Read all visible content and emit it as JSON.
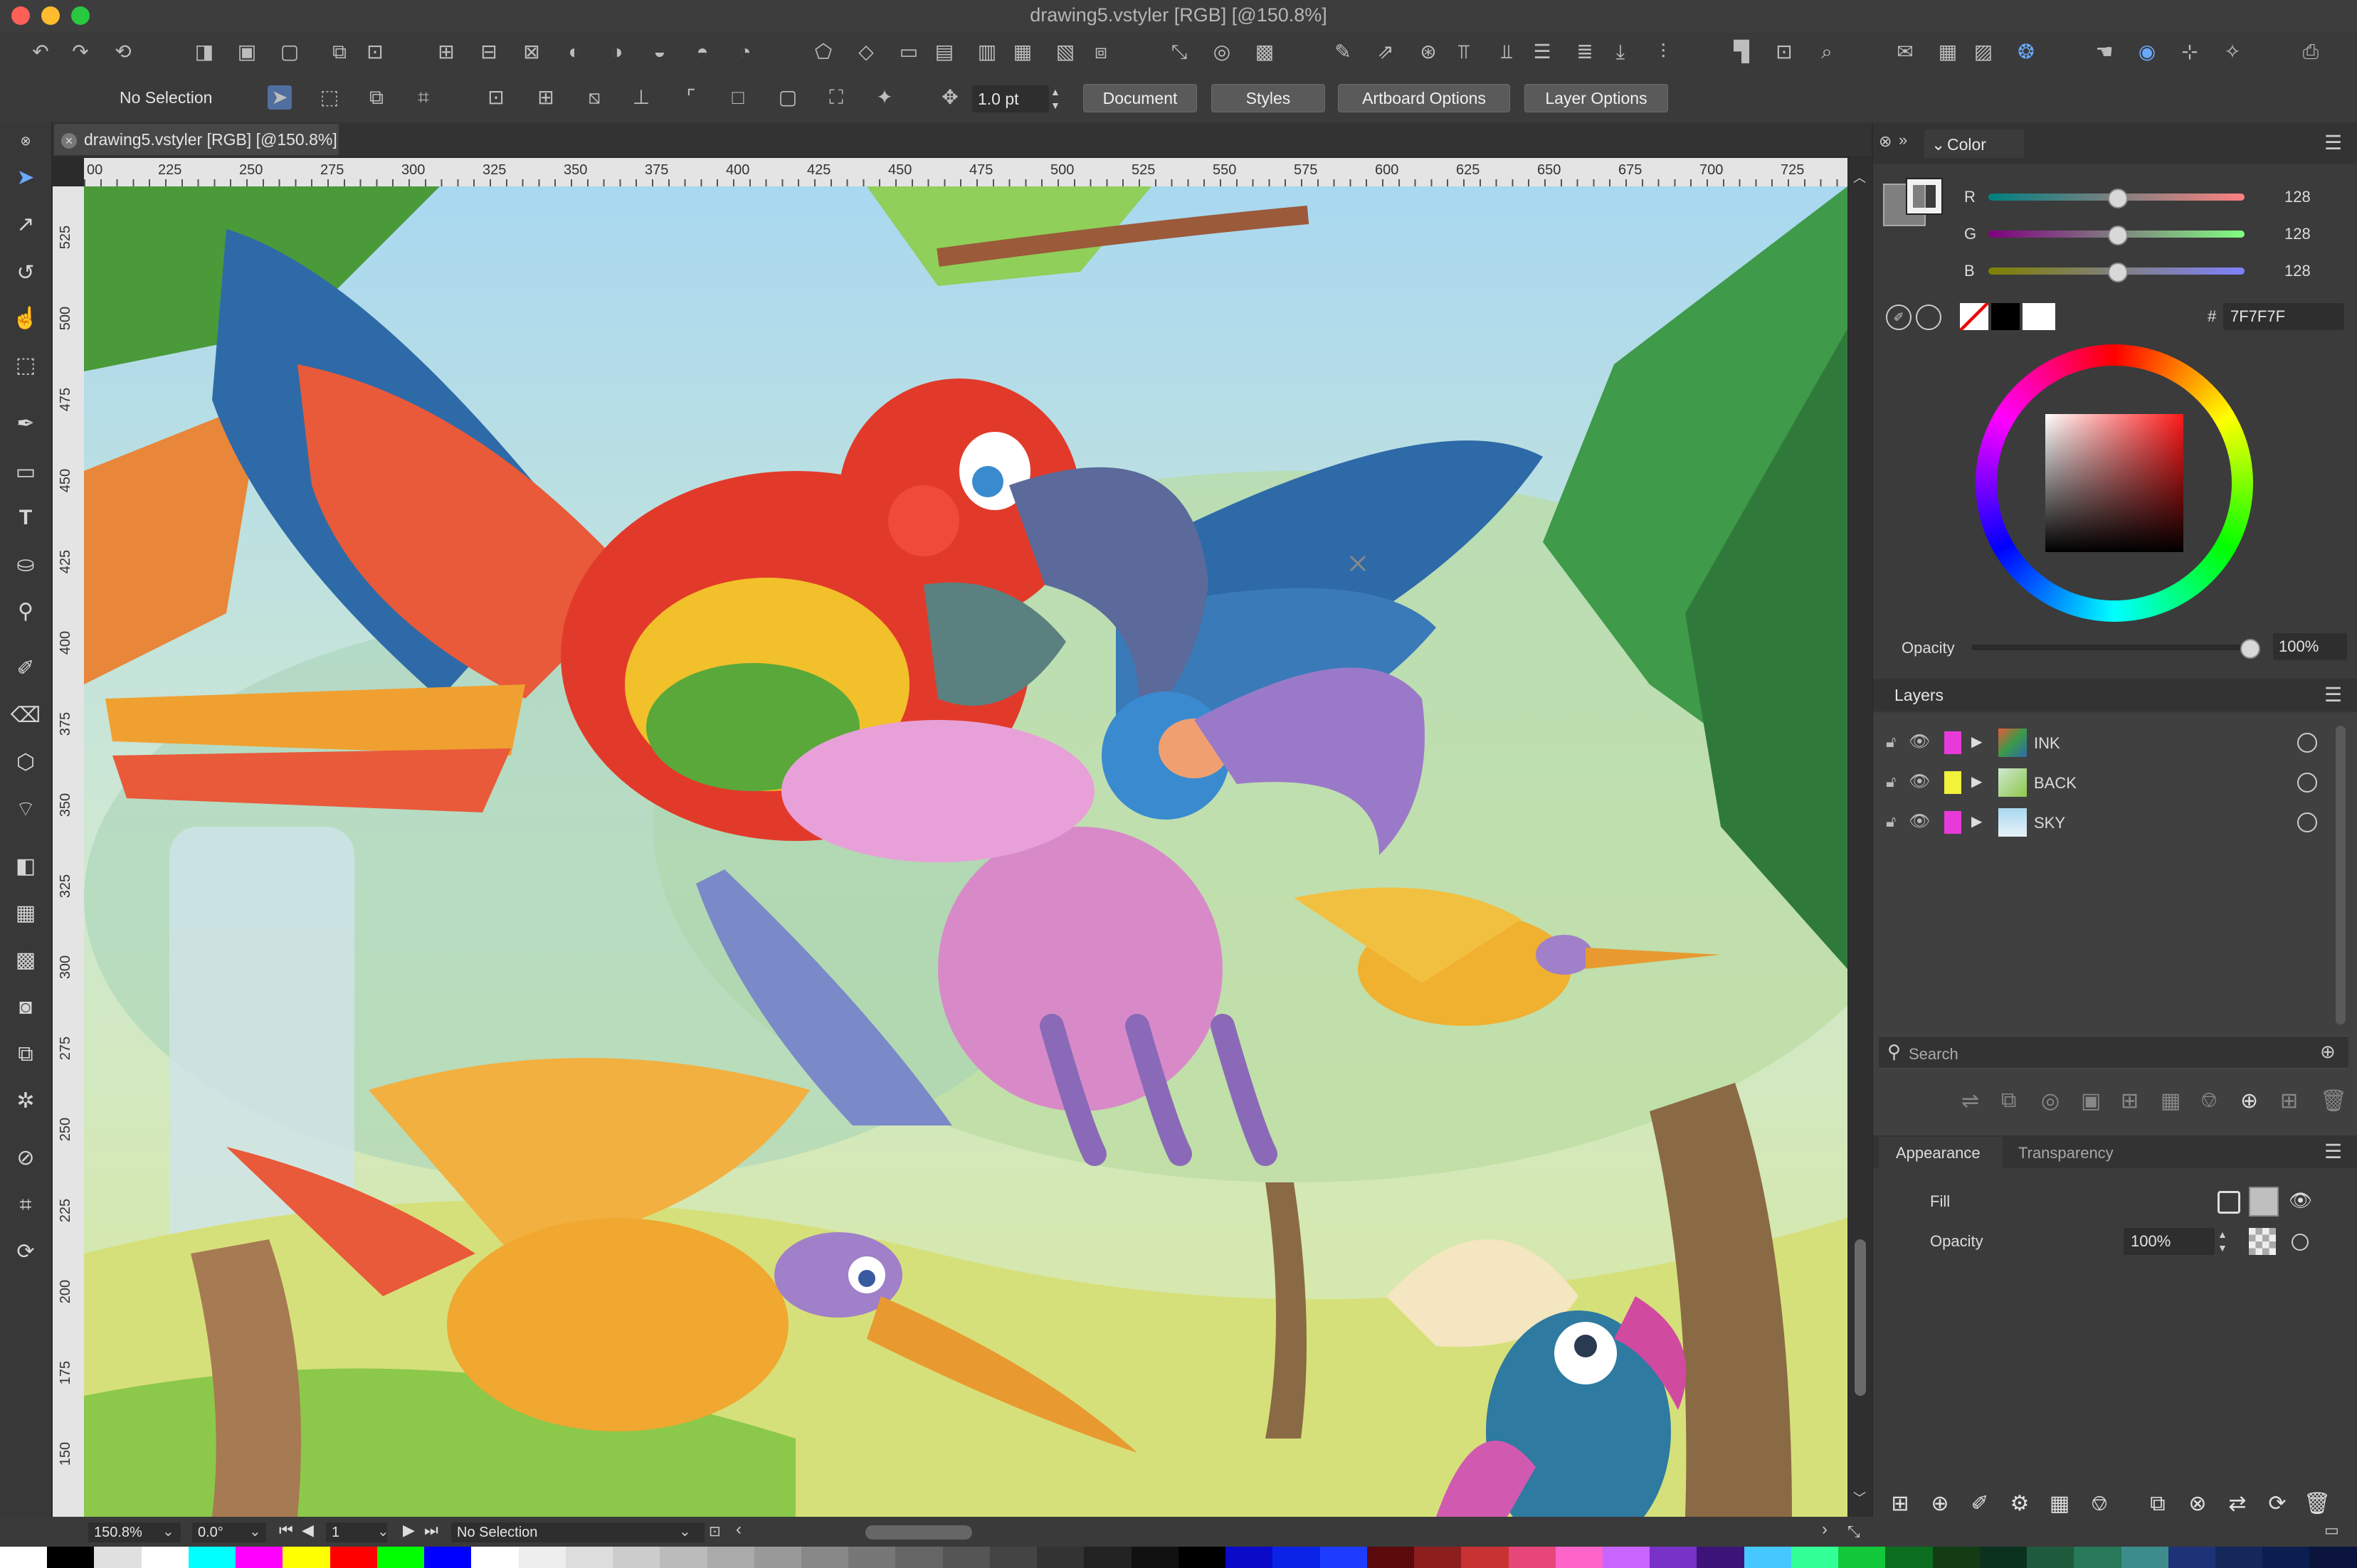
{
  "window": {
    "title": "drawing5.vstyler [RGB] [@150.8%]"
  },
  "toolbar": {
    "selection_label": "No Selection",
    "stroke_width": "1.0 pt",
    "buttons": [
      "Document",
      "Styles",
      "Artboard Options",
      "Layer Options"
    ]
  },
  "document_tab": {
    "label": "drawing5.vstyler [RGB] [@150.8%]"
  },
  "ruler": {
    "horizontal": [
      "00",
      "225",
      "250",
      "275",
      "300",
      "325",
      "350",
      "375",
      "400",
      "425",
      "450",
      "475",
      "500",
      "525",
      "550",
      "575",
      "600",
      "625",
      "650",
      "675",
      "700",
      "725"
    ],
    "vertical": [
      "525",
      "500",
      "475",
      "450",
      "425",
      "400",
      "375",
      "350",
      "325",
      "300",
      "275",
      "250",
      "225",
      "200",
      "175",
      "150"
    ]
  },
  "color_panel": {
    "title": "Color",
    "channels": [
      {
        "name": "R",
        "value": "128",
        "level": 0.5
      },
      {
        "name": "G",
        "value": "128",
        "level": 0.5
      },
      {
        "name": "B",
        "value": "128",
        "level": 0.5
      }
    ],
    "hex_prefix": "#",
    "hex": "7F7F7F",
    "opacity_label": "Opacity",
    "opacity_value": "100%"
  },
  "layers_panel": {
    "title": "Layers",
    "layers": [
      {
        "name": "INK",
        "color": "#e83ad8"
      },
      {
        "name": "BACK",
        "color": "#f2f23a"
      },
      {
        "name": "SKY",
        "color": "#e83ad8"
      }
    ],
    "search_placeholder": "Search"
  },
  "appearance_panel": {
    "tabs": [
      "Appearance",
      "Transparency"
    ],
    "fill_label": "Fill",
    "opacity_label": "Opacity",
    "opacity_value": "100%"
  },
  "statusbar": {
    "zoom": "150.8%",
    "rotation": "0.0°",
    "page": "1",
    "selection": "No Selection"
  },
  "colors": {
    "accent": "#3b7bd8",
    "swatches": [
      "#ffffff",
      "#000000",
      "#e0e0e0",
      "#ffffff",
      "#00ffff",
      "#ff00ff",
      "#ffff00",
      "#ff0000",
      "#00ff00",
      "#0000ff",
      "#ffffff",
      "#eeeeee",
      "#dddddd",
      "#cccccc",
      "#bbbbbb",
      "#aaaaaa",
      "#999999",
      "#888888",
      "#777777",
      "#666666",
      "#555555",
      "#444444",
      "#333333",
      "#222222",
      "#111111",
      "#000000",
      "#0a0ac8",
      "#0a23e6",
      "#1e3cff",
      "#5a0a0a",
      "#8c1e1e",
      "#c83232",
      "#e64678",
      "#ff64c8",
      "#c864ff",
      "#7832c8",
      "#3c1478",
      "#46c8ff",
      "#32ff96",
      "#14c83c",
      "#0a6e1e",
      "#143c14",
      "#0a321e",
      "#1e5a3c",
      "#28785a",
      "#3c8c8c",
      "#1e3278",
      "#14285a",
      "#0a1e50",
      "#0a143c"
    ]
  }
}
